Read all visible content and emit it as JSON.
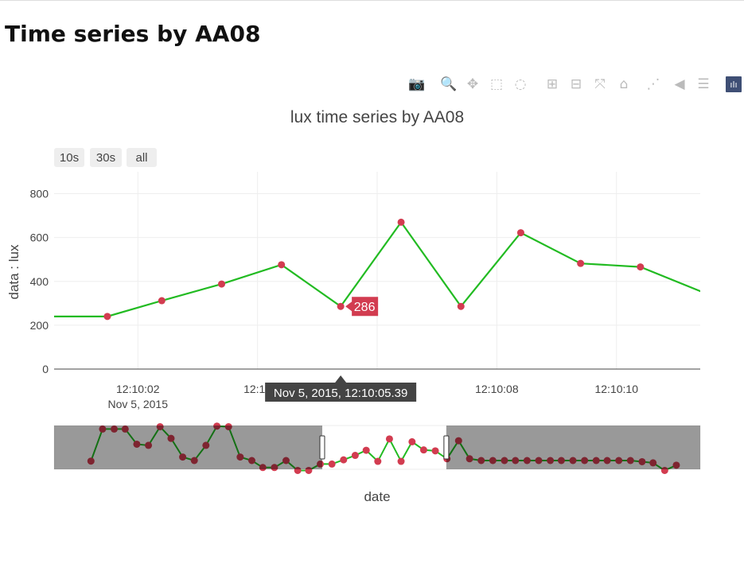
{
  "page": {
    "title": "Time series by AA08"
  },
  "modebar": {
    "buttons": [
      {
        "name": "camera-icon",
        "glyph": "📷",
        "active": false
      },
      {
        "name": "zoom-icon",
        "glyph": "🔍",
        "active": true
      },
      {
        "name": "pan-icon",
        "glyph": "✥",
        "active": false
      },
      {
        "name": "box-select-icon",
        "glyph": "⬚",
        "active": false
      },
      {
        "name": "lasso-select-icon",
        "glyph": "◌",
        "active": false
      },
      {
        "name": "zoom-in-icon",
        "glyph": "⊞",
        "active": false
      },
      {
        "name": "zoom-out-icon",
        "glyph": "⊟",
        "active": false
      },
      {
        "name": "autoscale-icon",
        "glyph": "⤧",
        "active": false
      },
      {
        "name": "home-icon",
        "glyph": "⌂",
        "active": false
      },
      {
        "name": "spike-lines-icon",
        "glyph": "⋰",
        "active": false
      },
      {
        "name": "hover-closest-icon",
        "glyph": "◀",
        "active": false
      },
      {
        "name": "hover-compare-icon",
        "glyph": "☰",
        "active": false
      },
      {
        "name": "plotly-logo-icon",
        "glyph": "ılı",
        "active": false
      }
    ]
  },
  "range_selector": {
    "buttons": [
      "10s",
      "30s",
      "all"
    ]
  },
  "chart_data": {
    "type": "line",
    "title": "lux time series by AA08",
    "xlabel": "date",
    "ylabel": "data : lux",
    "ylim": [
      0,
      900
    ],
    "yticks": [
      0,
      200,
      400,
      600,
      800
    ],
    "xlim_seconds": [
      0.6,
      11.4
    ],
    "xticks": [
      {
        "s": 2,
        "label": "12:10:02",
        "sub": "Nov 5, 2015"
      },
      {
        "s": 4,
        "label": "12:10"
      },
      {
        "s": 6,
        "label": ""
      },
      {
        "s": 8,
        "label": "12:10:08"
      },
      {
        "s": 10,
        "label": "12:10:10"
      }
    ],
    "grid": true,
    "line_color": "#22bb22",
    "marker_color": "#d23c50",
    "series": [
      {
        "points": [
          {
            "s": 0.2,
            "y": 240
          },
          {
            "s": 1.49,
            "y": 240
          },
          {
            "s": 2.4,
            "y": 312
          },
          {
            "s": 3.4,
            "y": 388
          },
          {
            "s": 4.4,
            "y": 476
          },
          {
            "s": 5.39,
            "y": 286
          },
          {
            "s": 6.4,
            "y": 670
          },
          {
            "s": 7.4,
            "y": 286
          },
          {
            "s": 8.4,
            "y": 622
          },
          {
            "s": 9.4,
            "y": 482
          },
          {
            "s": 10.4,
            "y": 466
          },
          {
            "s": 11.9,
            "y": 300
          }
        ]
      }
    ],
    "hover": {
      "value_label": "286",
      "date_label": "Nov 5, 2015, 12:10:05.39"
    },
    "rangeslider": {
      "ylim": [
        150,
        900
      ],
      "window_fraction": [
        0.415,
        0.607
      ],
      "series": [
        {
          "x": 0.057,
          "y": 290
        },
        {
          "x": 0.075,
          "y": 840
        },
        {
          "x": 0.093,
          "y": 840
        },
        {
          "x": 0.11,
          "y": 840
        },
        {
          "x": 0.128,
          "y": 580
        },
        {
          "x": 0.146,
          "y": 560
        },
        {
          "x": 0.164,
          "y": 880
        },
        {
          "x": 0.181,
          "y": 680
        },
        {
          "x": 0.199,
          "y": 360
        },
        {
          "x": 0.217,
          "y": 300
        },
        {
          "x": 0.235,
          "y": 560
        },
        {
          "x": 0.252,
          "y": 890
        },
        {
          "x": 0.27,
          "y": 880
        },
        {
          "x": 0.288,
          "y": 360
        },
        {
          "x": 0.306,
          "y": 300
        },
        {
          "x": 0.323,
          "y": 180
        },
        {
          "x": 0.341,
          "y": 180
        },
        {
          "x": 0.359,
          "y": 300
        },
        {
          "x": 0.377,
          "y": 130
        },
        {
          "x": 0.394,
          "y": 130
        },
        {
          "x": 0.412,
          "y": 240
        },
        {
          "x": 0.43,
          "y": 240
        },
        {
          "x": 0.448,
          "y": 312
        },
        {
          "x": 0.466,
          "y": 388
        },
        {
          "x": 0.483,
          "y": 476
        },
        {
          "x": 0.501,
          "y": 286
        },
        {
          "x": 0.519,
          "y": 670
        },
        {
          "x": 0.537,
          "y": 286
        },
        {
          "x": 0.554,
          "y": 622
        },
        {
          "x": 0.572,
          "y": 482
        },
        {
          "x": 0.59,
          "y": 466
        },
        {
          "x": 0.608,
          "y": 330
        },
        {
          "x": 0.626,
          "y": 640
        },
        {
          "x": 0.643,
          "y": 330
        },
        {
          "x": 0.661,
          "y": 300
        },
        {
          "x": 0.679,
          "y": 300
        },
        {
          "x": 0.697,
          "y": 300
        },
        {
          "x": 0.714,
          "y": 300
        },
        {
          "x": 0.732,
          "y": 300
        },
        {
          "x": 0.75,
          "y": 300
        },
        {
          "x": 0.768,
          "y": 300
        },
        {
          "x": 0.785,
          "y": 300
        },
        {
          "x": 0.803,
          "y": 300
        },
        {
          "x": 0.821,
          "y": 300
        },
        {
          "x": 0.839,
          "y": 300
        },
        {
          "x": 0.856,
          "y": 300
        },
        {
          "x": 0.874,
          "y": 300
        },
        {
          "x": 0.892,
          "y": 300
        },
        {
          "x": 0.91,
          "y": 280
        },
        {
          "x": 0.927,
          "y": 260
        },
        {
          "x": 0.945,
          "y": 130
        },
        {
          "x": 0.963,
          "y": 220
        }
      ]
    }
  }
}
